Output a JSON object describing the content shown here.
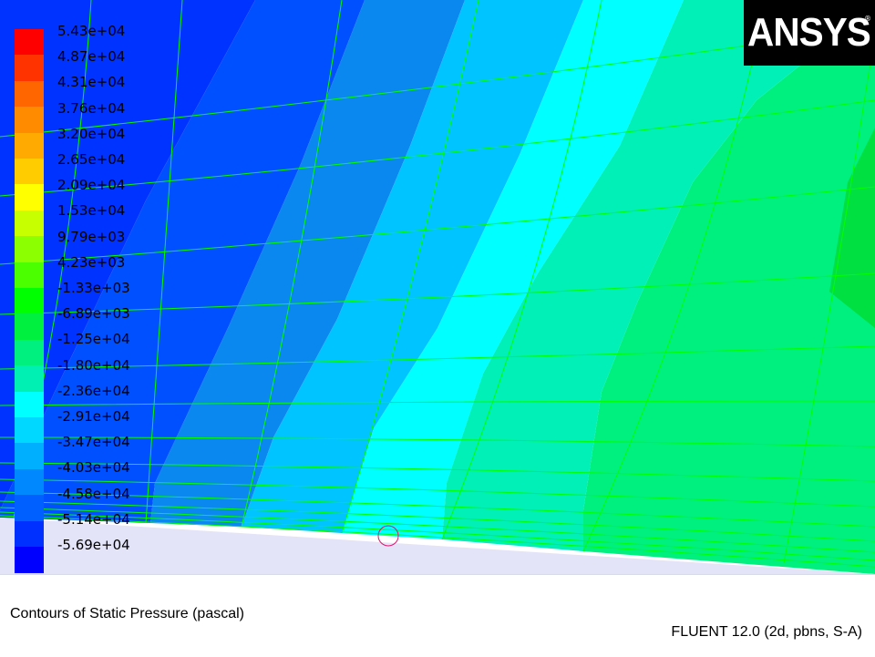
{
  "window": {
    "title": "Contours of Static Pressure (pascal)",
    "solver": "FLUENT 12.0 (2d, pbns, S-A)"
  },
  "brand": {
    "logo_text": "ANSYS",
    "logo_mark": "®",
    "background": "#000000",
    "foreground": "#ffffff"
  },
  "legend": {
    "labels": [
      "5.43e+04",
      "4.87e+04",
      "4.31e+04",
      "3.76e+04",
      "3.20e+04",
      "2.65e+04",
      "2.09e+04",
      "1.53e+04",
      "9.79e+03",
      "4.23e+03",
      "-1.33e+03",
      "-6.89e+03",
      "-1.25e+04",
      "-1.80e+04",
      "-2.36e+04",
      "-2.91e+04",
      "-3.47e+04",
      "-4.03e+04",
      "-4.58e+04",
      "-5.14e+04",
      "-5.69e+04"
    ],
    "colors": [
      "#ff0000",
      "#ff3300",
      "#ff6600",
      "#ff8c00",
      "#ffaa00",
      "#ffcc00",
      "#ffff00",
      "#c8ff00",
      "#8cff00",
      "#4bff00",
      "#00ff00",
      "#00f040",
      "#00f080",
      "#00f0b4",
      "#00ffff",
      "#00d8ff",
      "#00b0ff",
      "#0088ff",
      "#0060ff",
      "#0030ff",
      "#0000ff"
    ]
  },
  "colors": {
    "wall_region": "#e4e4f8",
    "mesh_lines": "#00ff00",
    "probe_marker": "#e0146e"
  }
}
